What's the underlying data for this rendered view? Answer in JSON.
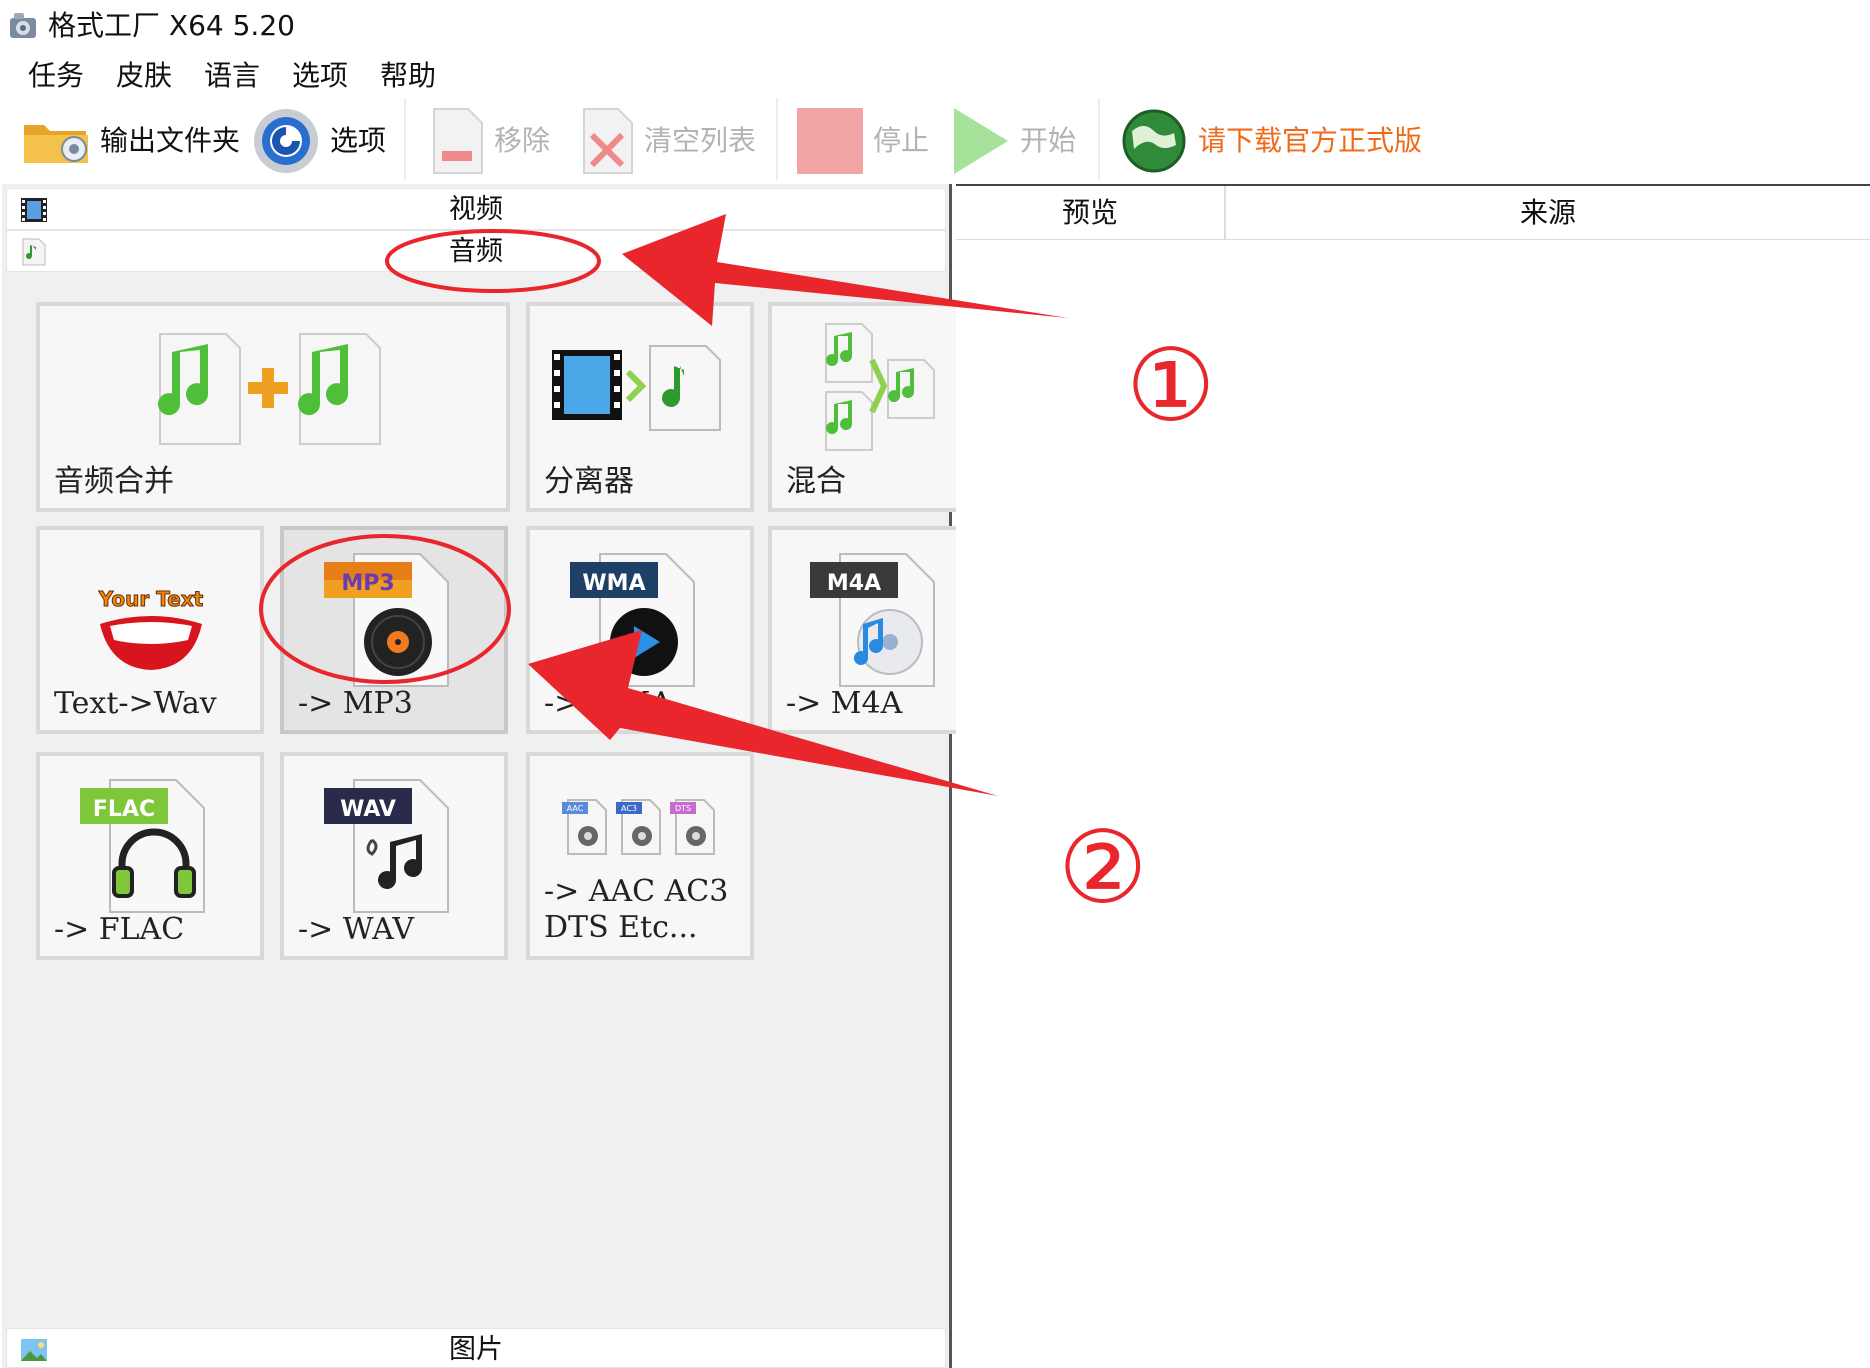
{
  "window": {
    "title": "格式工厂 X64 5.20"
  },
  "menu": [
    "任务",
    "皮肤",
    "语言",
    "选项",
    "帮助"
  ],
  "toolbar": {
    "output_folder": "输出文件夹",
    "options": "选项",
    "remove": "移除",
    "clear_list": "清空列表",
    "stop": "停止",
    "start": "开始",
    "download": "请下载官方正式版"
  },
  "categories": {
    "video": "视频",
    "audio": "音频",
    "image": "图片"
  },
  "tiles": {
    "merge": "音频合并",
    "splitter": "分离器",
    "mix": "混合",
    "text_wav": "Text->Wav",
    "mp3": "-> MP3",
    "wma": "-> WMA",
    "m4a": "-> M4A",
    "flac": "-> FLAC",
    "wav": "-> WAV",
    "aac": "-> AAC AC3\nDTS Etc..."
  },
  "badges": {
    "mp3": "MP3",
    "wma": "WMA",
    "m4a": "M4A",
    "flac": "FLAC",
    "wav": "WAV",
    "your_text": "Your Text",
    "aac": "AAC",
    "ac3": "AC3",
    "dts": "DTS"
  },
  "file_list": {
    "col_preview": "预览",
    "col_source": "来源"
  },
  "annotations": {
    "step1": "①",
    "step2": "②"
  },
  "colors": {
    "annotation_red": "#e8262c",
    "download_orange": "#f06a1a"
  }
}
